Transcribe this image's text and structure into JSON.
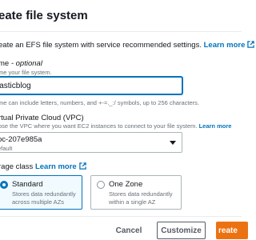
{
  "dialog": {
    "title": "eate file system",
    "intro_text": "eate an EFS file system with service recommended settings.",
    "intro_link": "Learn more"
  },
  "name_field": {
    "label": "me",
    "label_optional": " - optional",
    "description": "me your file system.",
    "value": "lasticblog",
    "constraint": "me can include letters, numbers, and +-=._:/ symbols, up to 256 characters."
  },
  "vpc_field": {
    "label": "rtual Private Cloud (VPC)",
    "description": "ose the VPC where you want EC2 instances to connect to your file system.",
    "description_link": "Learn more",
    "selected_value": "pc-207e985a",
    "selected_sub": "efault"
  },
  "storage_class": {
    "label": "rage class",
    "link": "Learn more",
    "options": [
      {
        "title": "Standard",
        "desc1": "Stores data redundantly",
        "desc2": "across multiple AZs",
        "selected": true
      },
      {
        "title": "One Zone",
        "desc1": "Stores data redundantly",
        "desc2": "within a single AZ",
        "selected": false
      }
    ]
  },
  "footer": {
    "cancel": "Cancel",
    "customize": "Customize",
    "create": "reate"
  },
  "colors": {
    "accent": "#0073bb",
    "primary_button": "#ec7211",
    "selected_tile_bg": "#f1faff"
  },
  "icons": {
    "external_link": "external-link-icon",
    "dropdown": "caret-down-icon",
    "radio": "radio-icon"
  }
}
